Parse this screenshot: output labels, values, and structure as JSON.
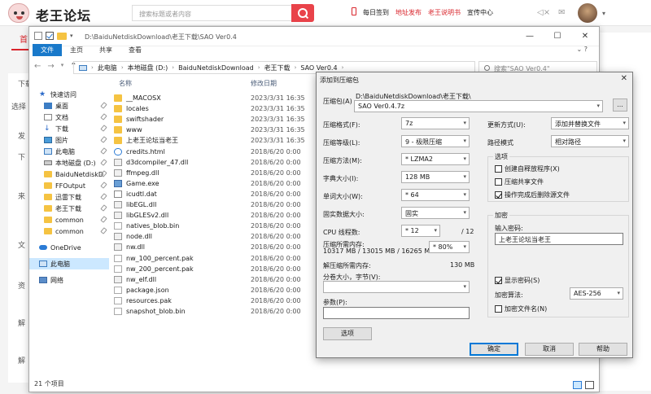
{
  "site": {
    "name": "老王论坛",
    "search_placeholder": "搜索标题或者内容",
    "links": [
      "每日签到",
      "地址发布",
      "老王说明书",
      "宣传中心"
    ],
    "left_texts": [
      "首",
      "下载",
      "选择",
      "发",
      "下",
      "来",
      "文",
      "资",
      "解",
      "解"
    ]
  },
  "explorer": {
    "title_path": "D:\\BaiduNetdiskDownload\\老王下载\\SAO Ver0.4",
    "window_buttons": [
      "—",
      "☐",
      "✕"
    ],
    "ribbon_tabs": [
      "文件",
      "主页",
      "共享",
      "查看"
    ],
    "address_segments": [
      "此电脑",
      "本地磁盘 (D:)",
      "BaiduNetdiskDownload",
      "老王下载",
      "SAO Ver0.4"
    ],
    "search_placeholder": "搜索\"SAO Ver0.4\"",
    "nav_items": [
      {
        "label": "快速访问",
        "icon": "star"
      },
      {
        "label": "桌面",
        "icon": "desktop"
      },
      {
        "label": "文档",
        "icon": "document"
      },
      {
        "label": "下载",
        "icon": "download"
      },
      {
        "label": "图片",
        "icon": "picture"
      },
      {
        "label": "此电脑",
        "icon": "pc"
      },
      {
        "label": "本地磁盘 (D:)",
        "icon": "drive"
      },
      {
        "label": "BaiduNetdiskD",
        "icon": "folder"
      },
      {
        "label": "FFOutput",
        "icon": "folder"
      },
      {
        "label": "迅雷下载",
        "icon": "folder"
      },
      {
        "label": "老王下载",
        "icon": "folder"
      },
      {
        "label": "common",
        "icon": "folder"
      },
      {
        "label": "common",
        "icon": "folder"
      },
      {
        "label": "OneDrive",
        "icon": "cloud"
      },
      {
        "label": "此电脑",
        "icon": "pc"
      },
      {
        "label": "网络",
        "icon": "network"
      }
    ],
    "columns": {
      "name": "名称",
      "date": "修改日期"
    },
    "files": [
      {
        "name": "__MACOSX",
        "date": "2023/3/31 16:35",
        "type": "folder"
      },
      {
        "name": "locales",
        "date": "2023/3/31 16:35",
        "type": "folder"
      },
      {
        "name": "swiftshader",
        "date": "2023/3/31 16:35",
        "type": "folder"
      },
      {
        "name": "www",
        "date": "2023/3/31 16:35",
        "type": "folder"
      },
      {
        "name": "上老王论坛当老王",
        "date": "2023/3/31 16:35",
        "type": "folder"
      },
      {
        "name": "credits.html",
        "date": "2018/6/20 0:00",
        "type": "html"
      },
      {
        "name": "d3dcompiler_47.dll",
        "date": "2018/6/20 0:00",
        "type": "dll"
      },
      {
        "name": "ffmpeg.dll",
        "date": "2018/6/20 0:00",
        "type": "dll"
      },
      {
        "name": "Game.exe",
        "date": "2018/6/20 0:00",
        "type": "exe"
      },
      {
        "name": "icudtl.dat",
        "date": "2018/6/20 0:00",
        "type": "dat"
      },
      {
        "name": "libEGL.dll",
        "date": "2018/6/20 0:00",
        "type": "dll"
      },
      {
        "name": "libGLESv2.dll",
        "date": "2018/6/20 0:00",
        "type": "dll"
      },
      {
        "name": "natives_blob.bin",
        "date": "2018/6/20 0:00",
        "type": "bin"
      },
      {
        "name": "node.dll",
        "date": "2018/6/20 0:00",
        "type": "dll"
      },
      {
        "name": "nw.dll",
        "date": "2018/6/20 0:00",
        "type": "dll"
      },
      {
        "name": "nw_100_percent.pak",
        "date": "2018/6/20 0:00",
        "type": "pak"
      },
      {
        "name": "nw_200_percent.pak",
        "date": "2018/6/20 0:00",
        "type": "pak"
      },
      {
        "name": "nw_elf.dll",
        "date": "2018/6/20 0:00",
        "type": "dll"
      },
      {
        "name": "package.json",
        "date": "2018/6/20 0:00",
        "type": "json"
      },
      {
        "name": "resources.pak",
        "date": "2018/6/20 0:00",
        "type": "pak"
      },
      {
        "name": "snapshot_blob.bin",
        "date": "2018/6/20 0:00",
        "type": "bin"
      }
    ],
    "status": "21 个项目"
  },
  "dialog": {
    "title": "添加到压缩包",
    "archive_label": "压缩包(A)",
    "archive_dir": "D:\\BaiduNetdiskDownload\\老王下载\\",
    "archive_name": "SAO Ver0.4.7z",
    "browse_label": "...",
    "format_label": "压缩格式(F):",
    "format_value": "7z",
    "level_label": "压缩等级(L):",
    "level_value": "9 - 极限压缩",
    "method_label": "压缩方法(M):",
    "method_value": "* LZMA2",
    "dict_label": "字典大小(I):",
    "dict_value": "128 MB",
    "word_label": "单词大小(W):",
    "word_value": "* 64",
    "solid_label": "固实数据大小:",
    "solid_value": "固实",
    "cpu_label": "CPU 线程数:",
    "cpu_value": "* 12",
    "cpu_max": "/ 12",
    "mem_label": "压缩所需内存:",
    "mem_detail": "10317 MB / 13015 MB / 16265 MB",
    "mem_percent": "* 80%",
    "decomp_label": "解压缩所需内存:",
    "decomp_value": "130 MB",
    "split_label": "分卷大小，字节(V):",
    "params_label": "参数(P):",
    "options_btn": "选项",
    "update_label": "更新方式(U):",
    "update_value": "添加并替换文件",
    "path_label": "路径模式",
    "path_value": "相对路径",
    "options_group": "选项",
    "opt_sfx": "创建自释放程序(X)",
    "opt_shared": "压缩共享文件",
    "opt_delete": "操作完成后删除源文件",
    "encrypt_group": "加密",
    "password_label": "输入密码:",
    "password_value": "上老王论坛当老王",
    "show_password": "显示密码(S)",
    "enc_method_label": "加密算法:",
    "enc_method_value": "AES-256",
    "enc_names": "加密文件名(N)",
    "ok": "确定",
    "cancel": "取消",
    "help": "帮助"
  }
}
